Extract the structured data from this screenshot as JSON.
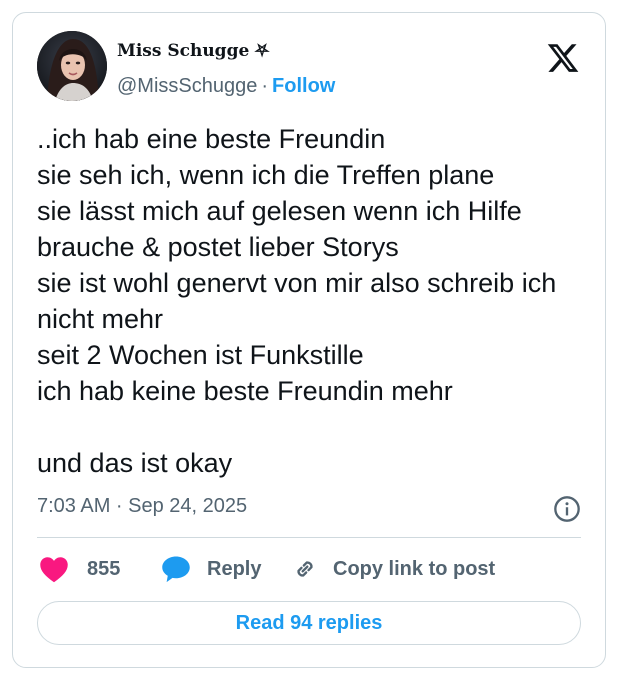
{
  "author": {
    "display_name": "Miss Schugge ⛧",
    "handle": "@MissSchugge",
    "separator": "·",
    "follow_label": "Follow"
  },
  "tweet": {
    "text": "..ich hab eine beste Freundin\nsie seh ich, wenn ich die Treffen plane\nsie lässt mich auf gelesen wenn ich Hilfe brauche & postet lieber Storys\nsie ist wohl genervt von mir also schreib ich nicht mehr\nseit 2 Wochen ist Funkstille\nich hab keine beste Freundin mehr\n\nund das ist okay",
    "timestamp": "7:03 AM · Sep 24, 2025"
  },
  "actions": {
    "like_count": "855",
    "reply_label": "Reply",
    "copy_link_label": "Copy link to post"
  },
  "footer": {
    "read_replies_label": "Read 94 replies"
  },
  "colors": {
    "like": "#f91880",
    "reply": "#1d9bf0",
    "link": "#1d9bf0",
    "text": "#0f1419",
    "muted": "#536471",
    "border": "#cfd9de"
  },
  "icons": {
    "brand": "x-logo-icon",
    "info": "info-icon",
    "like": "heart-icon",
    "reply": "speech-bubble-icon",
    "copy": "link-icon"
  }
}
